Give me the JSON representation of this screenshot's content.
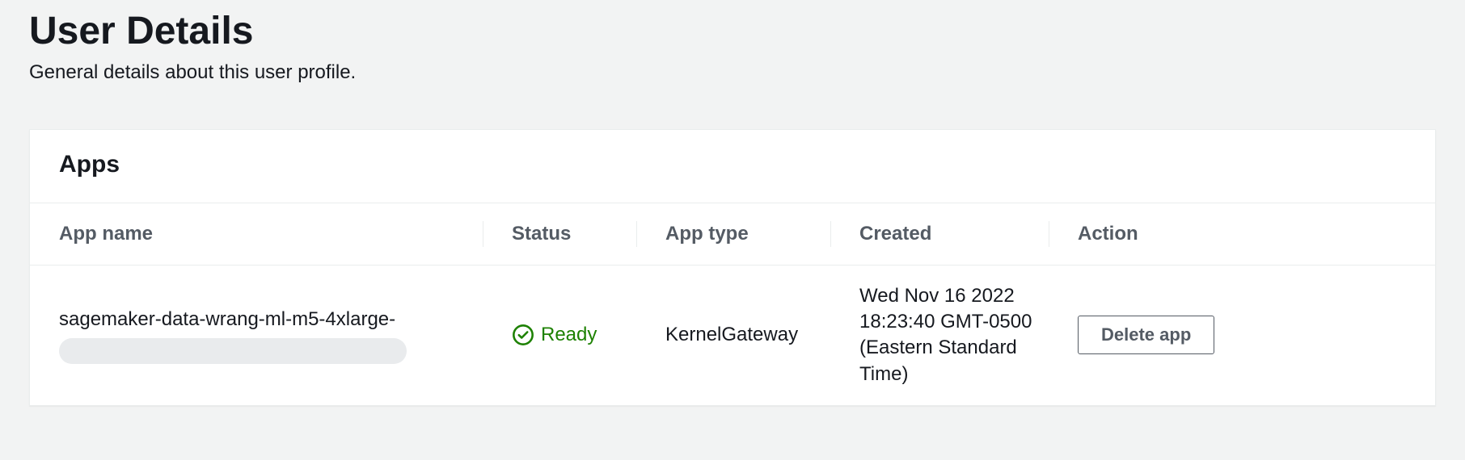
{
  "header": {
    "title": "User Details",
    "subtitle": "General details about this user profile."
  },
  "panel": {
    "title": "Apps",
    "columns": {
      "name": "App name",
      "status": "Status",
      "type": "App type",
      "created": "Created",
      "action": "Action"
    },
    "rows": [
      {
        "name": "sagemaker-data-wrang-ml-m5-4xlarge-",
        "status_label": "Ready",
        "status_color": "#1d8102",
        "type": "KernelGateway",
        "created": "Wed Nov 16 2022 18:23:40 GMT-0500 (Eastern Standard Time)",
        "action_label": "Delete app"
      }
    ]
  }
}
